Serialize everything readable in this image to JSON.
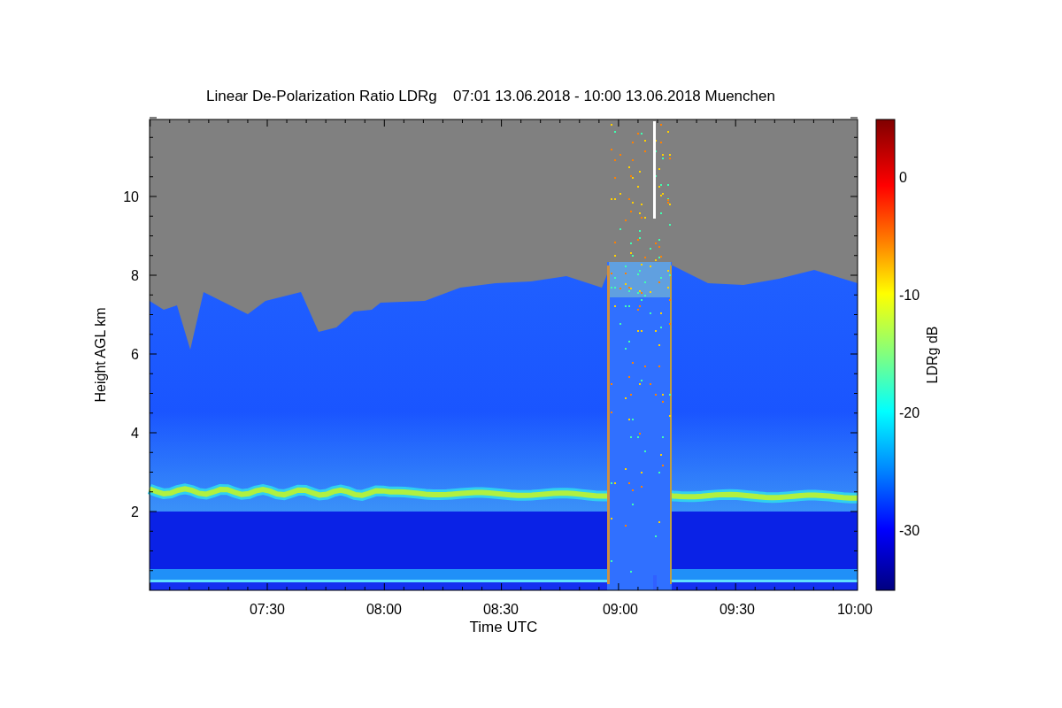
{
  "title": {
    "name": "Linear De-Polarization Ratio LDRg",
    "period": "07:01 13.06.2018 - 10:00 13.06.2018 Muenchen"
  },
  "plot": {
    "ylabel": "Height AGL km",
    "xlabel": "Time UTC",
    "yticks": [
      "10",
      "8",
      "6",
      "4",
      "2"
    ],
    "xticks": [
      "07:30",
      "08:00",
      "08:30",
      "09:00",
      "09:30",
      "10:00"
    ]
  },
  "colorbar": {
    "label": "LDRg dB",
    "ticks": [
      "0",
      "-10",
      "-20",
      "-30"
    ]
  }
}
